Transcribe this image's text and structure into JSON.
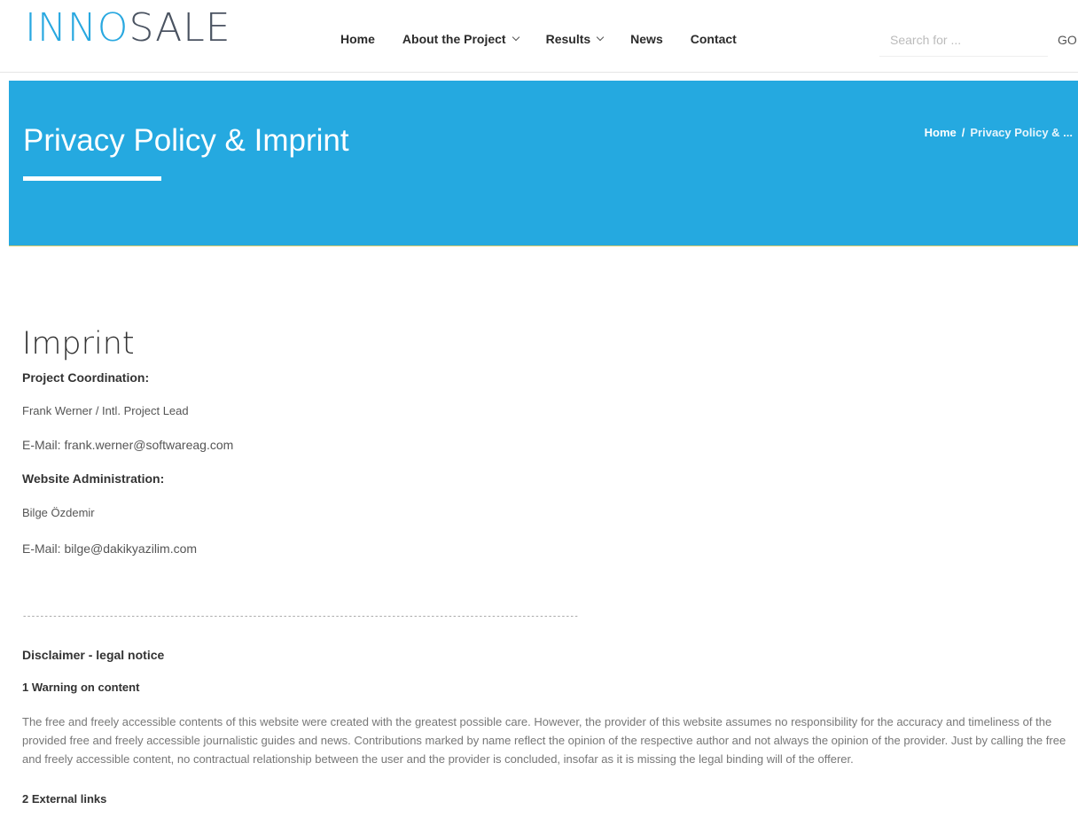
{
  "logo": {
    "part1": "INNO",
    "part2": "SALE"
  },
  "nav": {
    "items": [
      {
        "label": "Home",
        "dropdown": false
      },
      {
        "label": "About the Project",
        "dropdown": true
      },
      {
        "label": "Results",
        "dropdown": true
      },
      {
        "label": "News",
        "dropdown": false
      },
      {
        "label": "Contact",
        "dropdown": false
      }
    ]
  },
  "search": {
    "placeholder": "Search for ...",
    "button": "GO"
  },
  "hero": {
    "title": "Privacy Policy & Imprint",
    "breadcrumb": {
      "home": "Home",
      "separator": "/",
      "current": "Privacy Policy & ..."
    }
  },
  "main": {
    "heading": "Imprint",
    "coordination_label": "Project Coordination:",
    "coordination_name": "Frank Werner / Intl. Project Lead",
    "coordination_email": "E-Mail: frank.werner@softwareag.com",
    "admin_label": "Website Administration:",
    "admin_name": "Bilge Özdemir",
    "admin_email": "E-Mail: bilge@dakikyazilim.com",
    "divider": "--------------------------------------------------------------------------------------------------------------------------------------------------",
    "disclaimer_title": "Disclaimer - legal notice",
    "section1_title": "1 Warning on content",
    "section1_text": "The free and freely accessible contents of this website were created with the greatest possible care. However, the provider of this website assumes no responsibility for the accuracy and timeliness of the provided free and freely accessible journalistic guides and news. Contributions marked by name reflect the opinion of the respective author and not always the opinion of the provider. Just by calling the free and freely accessible content, no contractual relationship between the user and the provider is concluded, insofar as it is missing the legal binding will of the offerer.",
    "section2_title": "2 External links"
  },
  "colors": {
    "brand_blue": "#25a9e0",
    "logo_dark": "#4a5361"
  }
}
